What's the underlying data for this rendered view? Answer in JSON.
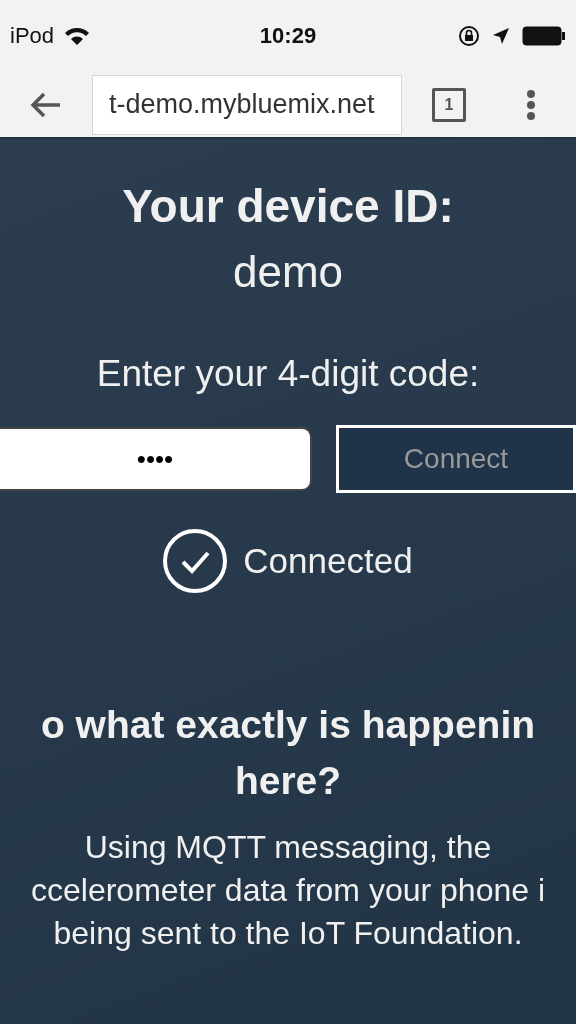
{
  "status_bar": {
    "carrier": "iPod",
    "time": "10:29"
  },
  "browser": {
    "url": "t-demo.mybluemix.net",
    "tab_count": "1"
  },
  "device": {
    "title": "Your device ID:",
    "id": "demo"
  },
  "code_form": {
    "label": "Enter your 4-digit code:",
    "value": "••••",
    "button": {
      "label": "Connect",
      "disabled": true
    }
  },
  "status": {
    "connected": true,
    "label": "Connected"
  },
  "explanation": {
    "heading_lines": [
      "o what exactly is happenin",
      "here?"
    ],
    "body_lines": [
      "Using MQTT messaging, the",
      "ccelerometer data from your phone i",
      "being sent to the IoT Foundation."
    ]
  }
}
